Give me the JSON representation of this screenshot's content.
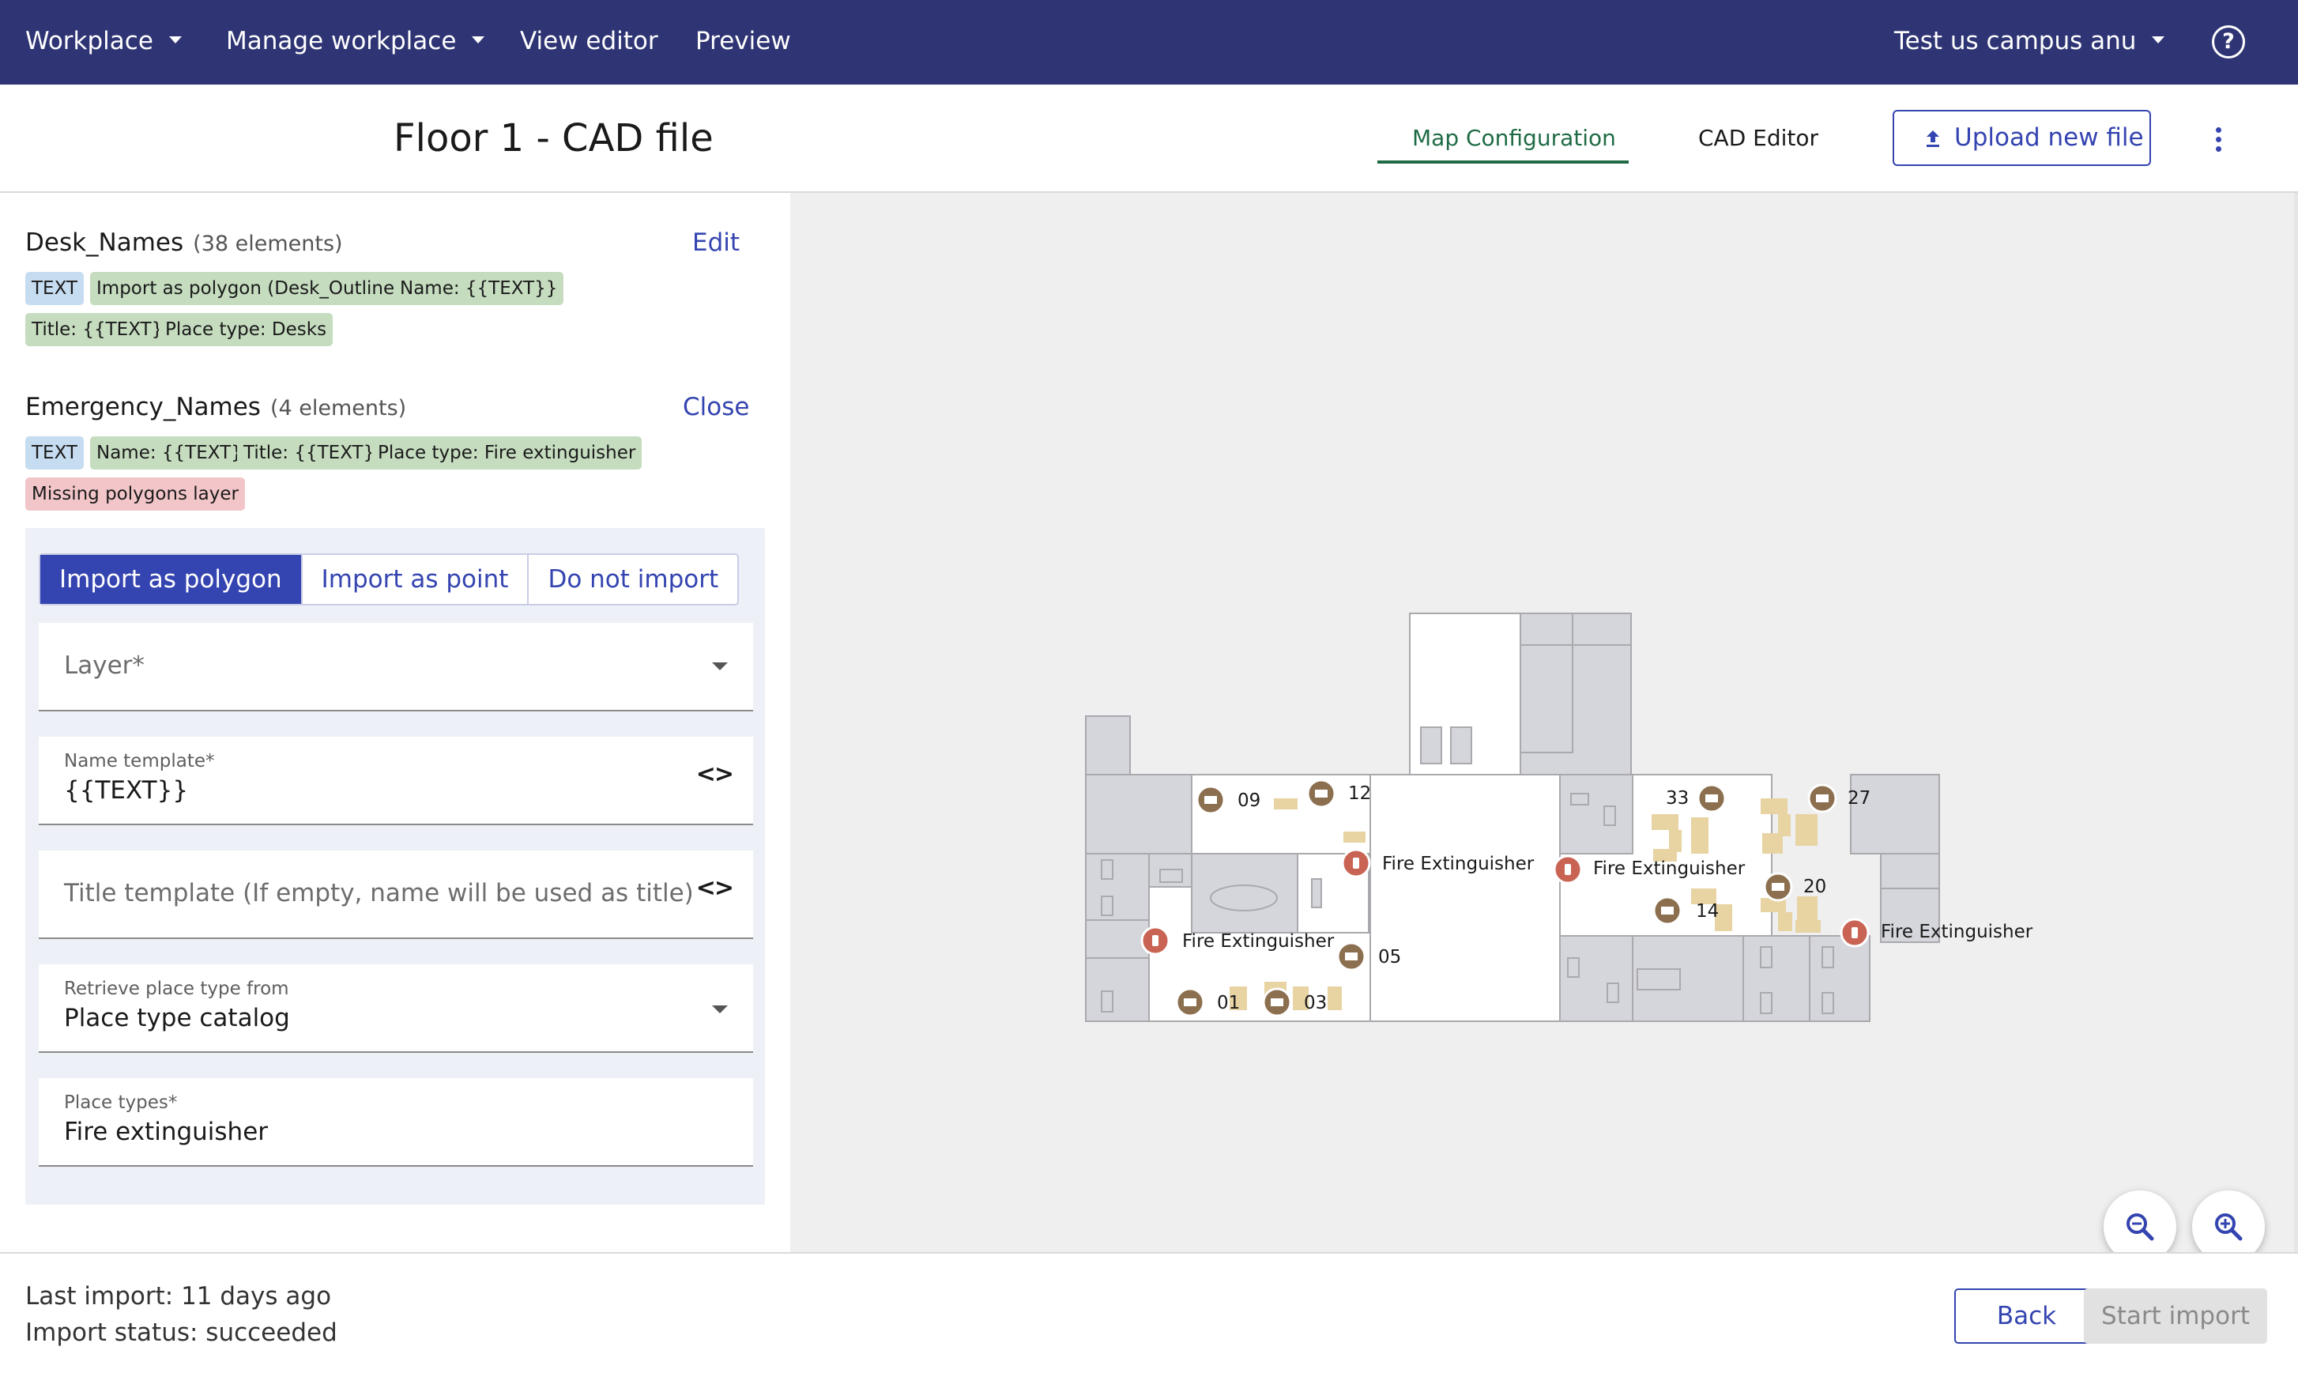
{
  "topnav": {
    "workplace": "Workplace",
    "manage_workplace": "Manage workplace",
    "view_editor": "View editor",
    "preview": "Preview",
    "campus": "Test us campus anu",
    "help_icon": "help-circle-icon"
  },
  "header": {
    "title": "Floor 1 - CAD file",
    "tab_map": "Map Configuration",
    "tab_cad": "CAD Editor",
    "upload_label": "Upload new file",
    "upload_icon": "upload-icon",
    "menu_icon": "more-vertical-icon"
  },
  "layers": [
    {
      "name": "Desk_Names",
      "count": "(38 elements)",
      "action": "Edit",
      "chips": [
        "TEXT",
        "Import as polygon (Desk_Outlines)",
        "Name: {{TEXT}}",
        "Title: {{TEXT}}",
        "Place type: Desks"
      ]
    },
    {
      "name": "Emergency_Names",
      "count": "(4 elements)",
      "action": "Close",
      "chips": [
        "TEXT",
        "Name: {{TEXT}}",
        "Title: {{TEXT}}",
        "Place type: Fire extinguisher",
        "Missing polygons layer"
      ]
    }
  ],
  "form": {
    "mode_options": [
      "Import as polygon",
      "Import as point",
      "Do not import"
    ],
    "selected_mode": "Import as polygon",
    "layer_placeholder": "Layer*",
    "name_template_label": "Name template*",
    "name_template_value": "{{TEXT}}",
    "title_template_placeholder": "Title template (If empty, name will be used as title)",
    "retrieve_label": "Retrieve place type from",
    "retrieve_value": "Place type catalog",
    "place_types_label": "Place types*",
    "place_types_value": "Fire extinguisher"
  },
  "map": {
    "labels": {
      "desk_09": "09",
      "desk_12": "12",
      "desk_33": "33",
      "desk_27": "27",
      "desk_20": "20",
      "desk_14": "14",
      "desk_05": "05",
      "desk_01": "01",
      "desk_03": "03",
      "fire_1": "Fire Extinguisher",
      "fire_2": "Fire Extinguisher",
      "fire_3": "Fire Extinguisher",
      "fire_4": "Fire Extinguisher"
    },
    "colors": {
      "desk_marker": "#8b6f4e",
      "fire_marker": "#c96454",
      "desk_fill": "#e8d3a3"
    },
    "zoom_out_icon": "zoom-out-icon",
    "zoom_in_icon": "zoom-in-icon"
  },
  "footer": {
    "last_import": "Last import: 11 days ago",
    "import_status": "Import status: succeeded",
    "back": "Back",
    "start_import": "Start import"
  },
  "colors": {
    "nav_bg": "#2f3574",
    "accent": "#3444b0",
    "active_tab": "#1f6b45"
  }
}
